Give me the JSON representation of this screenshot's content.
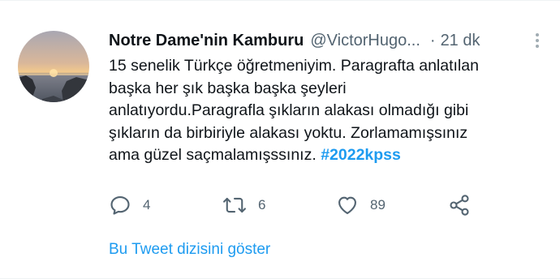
{
  "tweet": {
    "display_name": "Notre Dame'nin Kamburu",
    "handle": "@VictorHugo...",
    "separator": "·",
    "time": "21 dk",
    "text_lines": [
      "15 senelik Türkçe öğretmeniyim. Paragrafta anlatılan",
      "başka her şık başka başka şeyleri",
      "anlatıyordu.Paragrafla şıkların alakası olmadığı gibi",
      "şıkların da birbiriyle alakası yoktu. Zorlamamışsınız",
      "ama güzel saçmalamışssınız. "
    ],
    "hashtag": "#2022kpss"
  },
  "actions": {
    "reply_count": "4",
    "retweet_count": "6",
    "like_count": "89"
  },
  "show_thread_label": "Bu Tweet dizisini göster",
  "icons": {
    "more": "more-vertical-icon",
    "reply": "reply-icon",
    "retweet": "retweet-icon",
    "like": "heart-icon",
    "share": "share-icon"
  },
  "colors": {
    "accent": "#1d9bf0",
    "secondary_text": "#536471",
    "primary_text": "#0f1419",
    "icon": "#536471"
  }
}
